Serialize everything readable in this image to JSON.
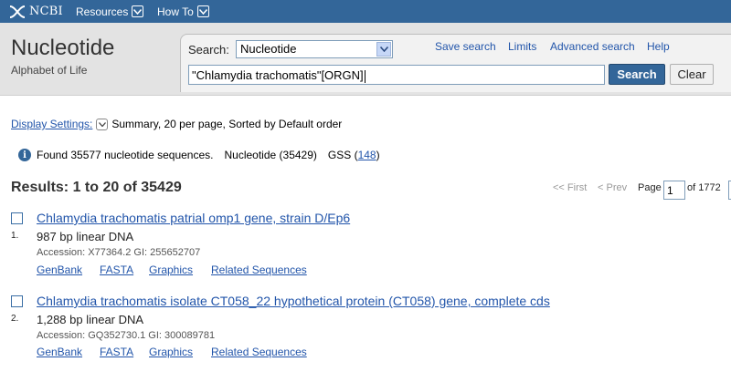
{
  "topbar": {
    "logo_text": "NCBI",
    "nav": [
      "Resources",
      "How To"
    ]
  },
  "header": {
    "title": "Nucleotide",
    "subtitle": "Alphabet of Life"
  },
  "search": {
    "label": "Search:",
    "database": "Nucleotide",
    "links": [
      "Save search",
      "Limits",
      "Advanced search",
      "Help"
    ],
    "query": "\"Chlamydia trachomatis\"[ORGN]",
    "search_button": "Search",
    "clear_button": "Clear"
  },
  "display": {
    "settings_label": "Display Settings:",
    "summary": "Summary, 20 per page, Sorted by Default order"
  },
  "found": {
    "text": "Found 35577 nucleotide sequences.",
    "nucleotide_label": "Nucleotide (35429)",
    "gss_prefix": "GSS (",
    "gss_count": "148",
    "gss_suffix": ")"
  },
  "results": {
    "heading": "Results: 1 to 20 of 35429",
    "pager": {
      "first": "<< First",
      "prev": "< Prev",
      "page_label": "Page",
      "page_value": "1",
      "of_label": "of 1772"
    },
    "items": [
      {
        "number": "1.",
        "title": "Chlamydia trachomatis patrial omp1 gene, strain D/Ep6",
        "desc": "987 bp linear DNA",
        "accession": "Accession: X77364.2   GI: 255652707",
        "links": [
          "GenBank",
          "FASTA",
          "Graphics",
          "Related Sequences"
        ]
      },
      {
        "number": "2.",
        "title": "Chlamydia trachomatis isolate CT058_22 hypothetical protein (CT058) gene, complete cds",
        "desc": "1,288 bp linear DNA",
        "accession": "Accession: GQ352730.1   GI: 300089781",
        "links": [
          "GenBank",
          "FASTA",
          "Graphics",
          "Related Sequences"
        ]
      }
    ]
  },
  "colors": {
    "topbar": "#336699",
    "link": "#2255aa",
    "header_bg": "#e3e3e3"
  }
}
